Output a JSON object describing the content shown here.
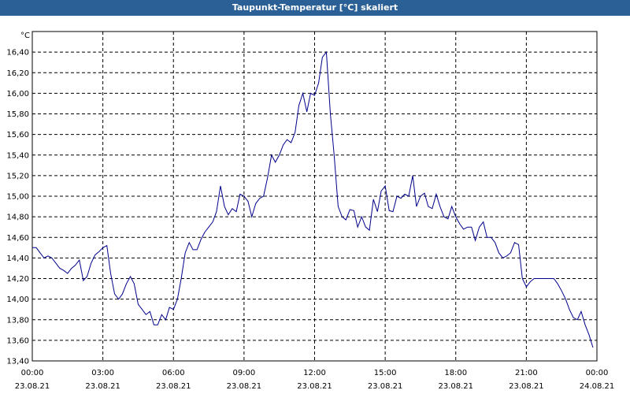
{
  "window": {
    "title": "Taupunkt-Temperatur [°C] skaliert"
  },
  "chart_data": {
    "type": "line",
    "title": "Taupunkt-Temperatur [°C] skaliert",
    "ylabel": "°C",
    "xlabel": "",
    "ylim": [
      13.4,
      16.6
    ],
    "xlim": [
      0,
      24
    ],
    "grid": true,
    "colors": {
      "line": "#00008b",
      "grid": "#000000",
      "titlebar": "#2a6095"
    },
    "y_ticks": [
      "13,40",
      "13,60",
      "13,80",
      "14,00",
      "14,20",
      "14,40",
      "14,60",
      "14,80",
      "15,00",
      "15,20",
      "15,40",
      "15,60",
      "15,80",
      "16,00",
      "16,20",
      "16,40"
    ],
    "y_tick_values": [
      13.4,
      13.6,
      13.8,
      14.0,
      14.2,
      14.4,
      14.6,
      14.8,
      15.0,
      15.2,
      15.4,
      15.6,
      15.8,
      16.0,
      16.2,
      16.4
    ],
    "x_ticks": [
      {
        "time": "00:00",
        "date": "23.08.21",
        "hour": 0
      },
      {
        "time": "03:00",
        "date": "23.08.21",
        "hour": 3
      },
      {
        "time": "06:00",
        "date": "23.08.21",
        "hour": 6
      },
      {
        "time": "09:00",
        "date": "23.08.21",
        "hour": 9
      },
      {
        "time": "12:00",
        "date": "23.08.21",
        "hour": 12
      },
      {
        "time": "15:00",
        "date": "23.08.21",
        "hour": 15
      },
      {
        "time": "18:00",
        "date": "23.08.21",
        "hour": 18
      },
      {
        "time": "21:00",
        "date": "23.08.21",
        "hour": 21
      },
      {
        "time": "00:00",
        "date": "24.08.21",
        "hour": 24
      }
    ],
    "series": [
      {
        "hours": [
          0.0,
          0.17,
          0.33,
          0.5,
          0.67,
          0.83,
          1.0,
          1.17,
          1.33,
          1.5,
          1.67,
          1.83,
          2.0,
          2.17,
          2.33,
          2.5,
          2.67,
          2.83,
          3.0,
          3.17,
          3.33,
          3.5,
          3.67,
          3.83,
          4.0,
          4.17,
          4.33,
          4.5,
          4.67,
          4.83,
          5.0,
          5.17,
          5.33,
          5.5,
          5.67,
          5.83,
          6.0,
          6.17,
          6.33,
          6.5,
          6.67,
          6.83,
          7.0,
          7.17,
          7.33,
          7.5,
          7.67,
          7.83,
          8.0,
          8.17,
          8.33,
          8.5,
          8.67,
          8.83,
          9.0,
          9.17,
          9.33,
          9.5,
          9.67,
          9.83,
          10.0,
          10.17,
          10.33,
          10.5,
          10.67,
          10.83,
          11.0,
          11.17,
          11.33,
          11.5,
          11.67,
          11.83,
          12.0,
          12.17,
          12.33,
          12.5,
          12.67,
          12.83,
          13.0,
          13.17,
          13.33,
          13.5,
          13.67,
          13.83,
          14.0,
          14.17,
          14.33,
          14.5,
          14.67,
          14.83,
          15.0,
          15.17,
          15.33,
          15.5,
          15.67,
          15.83,
          16.0,
          16.17,
          16.33,
          16.5,
          16.67,
          16.83,
          17.0,
          17.17,
          17.33,
          17.5,
          17.67,
          17.83,
          18.0,
          18.17,
          18.33,
          18.5,
          18.67,
          18.83,
          19.0,
          19.17,
          19.33,
          19.5,
          19.67,
          19.83,
          20.0,
          20.17,
          20.33,
          20.5,
          20.67,
          20.83,
          21.0,
          21.17,
          21.33,
          21.5,
          21.67,
          21.83,
          22.0,
          22.17,
          22.33,
          22.5,
          22.67,
          22.83,
          23.0,
          23.17,
          23.33,
          23.5,
          23.67,
          23.83
        ],
        "values": [
          14.5,
          14.5,
          14.45,
          14.4,
          14.42,
          14.4,
          14.35,
          14.3,
          14.28,
          14.25,
          14.3,
          14.33,
          14.38,
          14.18,
          14.22,
          14.35,
          14.43,
          14.46,
          14.5,
          14.52,
          14.25,
          14.05,
          14.0,
          14.05,
          14.15,
          14.22,
          14.15,
          13.95,
          13.9,
          13.85,
          13.88,
          13.75,
          13.75,
          13.85,
          13.8,
          13.92,
          13.9,
          14.0,
          14.2,
          14.45,
          14.55,
          14.48,
          14.48,
          14.58,
          14.65,
          14.7,
          14.75,
          14.85,
          15.1,
          14.9,
          14.82,
          14.88,
          14.85,
          15.02,
          15.0,
          14.95,
          14.8,
          14.93,
          14.98,
          15.0,
          15.18,
          15.4,
          15.33,
          15.4,
          15.5,
          15.55,
          15.52,
          15.62,
          15.88,
          16.0,
          15.82,
          16.0,
          15.98,
          16.1,
          16.35,
          16.4,
          15.8,
          15.4,
          14.9,
          14.8,
          14.77,
          14.87,
          14.86,
          14.7,
          14.8,
          14.7,
          14.67,
          14.97,
          14.85,
          15.05,
          15.1,
          14.86,
          14.85,
          15.0,
          14.98,
          15.02,
          15.0,
          15.2,
          14.9,
          15.0,
          15.03,
          14.9,
          14.88,
          15.02,
          14.9,
          14.8,
          14.78,
          14.9,
          14.8,
          14.73,
          14.68,
          14.7,
          14.7,
          14.57,
          14.7,
          14.75,
          14.6,
          14.6,
          14.55,
          14.45,
          14.4,
          14.42,
          14.45,
          14.55,
          14.53,
          14.2,
          14.12,
          14.17,
          14.2,
          14.2,
          14.2,
          14.2,
          14.2,
          14.2,
          14.15,
          14.08,
          14.0,
          13.9,
          13.82,
          13.8,
          13.88,
          13.75,
          13.65,
          13.53
        ]
      }
    ]
  }
}
